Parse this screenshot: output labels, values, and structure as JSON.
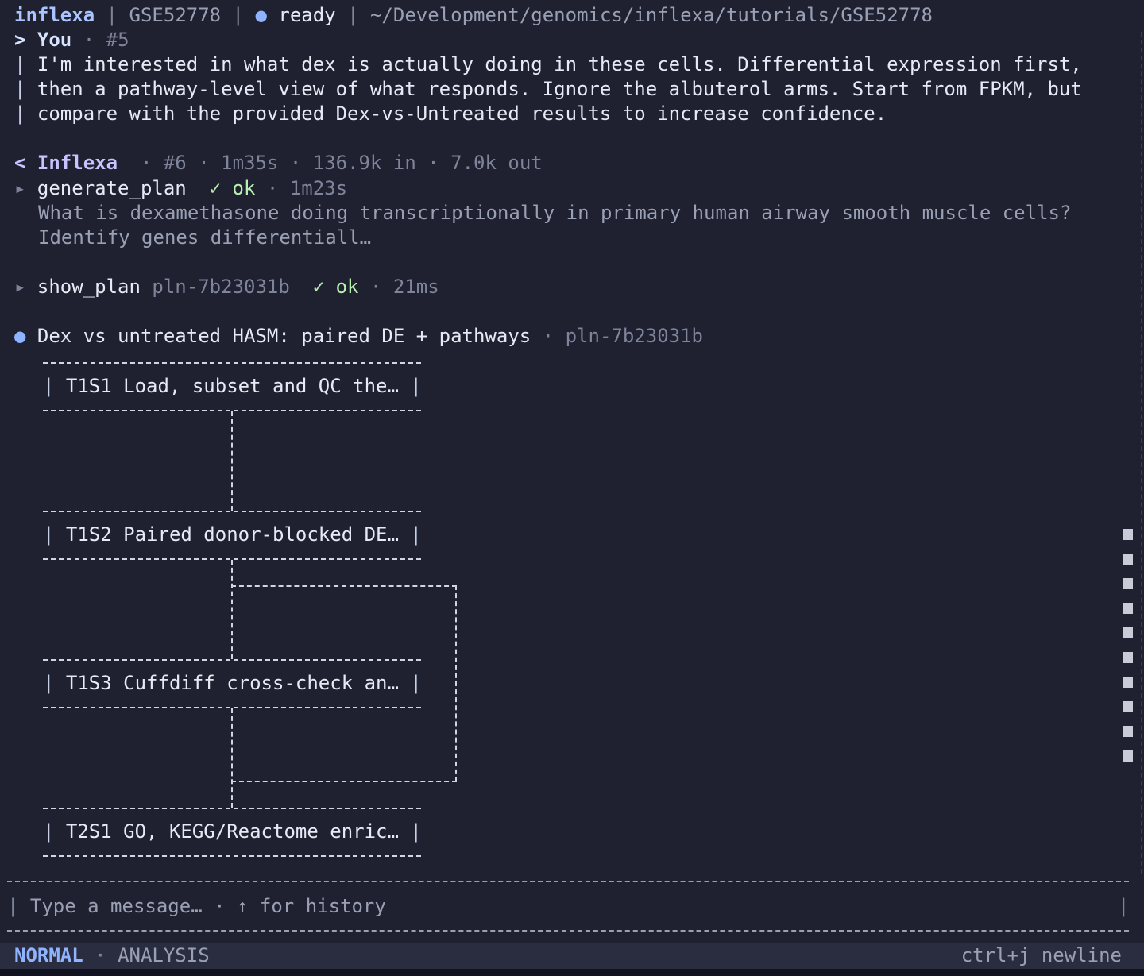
{
  "titlebar": {
    "app": "inflexa",
    "dataset": "GSE52778",
    "status": "ready",
    "path": "~/Development/genomics/inflexa/tutorials/GSE52778"
  },
  "user_message": {
    "sender": "You",
    "id": "#5",
    "lines": [
      "I'm interested in what dex is actually doing in these cells. Differential expression first,",
      "then a pathway-level view of what responds. Ignore the albuterol arms. Start from FPKM, but",
      "compare with the provided Dex-vs-Untreated results to increase confidence."
    ]
  },
  "assistant": {
    "sender": "Inflexa",
    "id": "#6",
    "duration": "1m35s",
    "tokens_in": "136.9k in",
    "tokens_out": "7.0k out"
  },
  "tool_calls": [
    {
      "name": "generate_plan",
      "arg": "",
      "status": "✓ ok",
      "time": "1m23s",
      "output": [
        "What is dexamethasone doing transcriptionally in primary human airway smooth muscle cells?",
        "Identify genes differentiall…"
      ]
    },
    {
      "name": "show_plan",
      "arg": "pln-7b23031b",
      "status": "✓ ok",
      "time": "21ms"
    }
  ],
  "plan": {
    "title": "Dex vs untreated HASM: paired DE + pathways",
    "id": "pln-7b23031b",
    "nodes": [
      "T1S1 Load, subset and QC the…",
      "T1S2 Paired donor-blocked DE…",
      "T1S3 Cuffdiff cross-check an…",
      "T2S1 GO, KEGG/Reactome enric…"
    ]
  },
  "input": {
    "placeholder": "Type a message… · ↑ for history"
  },
  "statusbar": {
    "mode": "NORMAL",
    "context": "ANALYSIS",
    "hint": "ctrl+j newline"
  },
  "colors": {
    "background": "#1f2030",
    "accent": "#8fb3ff",
    "ok": "#b7f0b0"
  }
}
